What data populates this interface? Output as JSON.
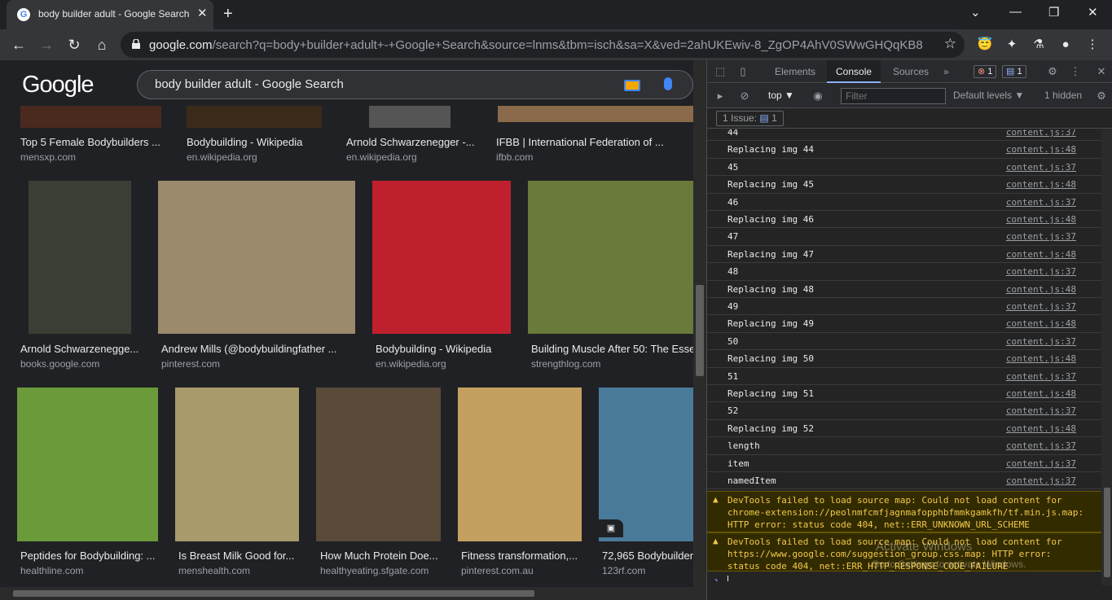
{
  "browser": {
    "tab_title": "body builder adult - Google Search",
    "url_host": "google.com",
    "url_rest": "/search?q=body+builder+adult+-+Google+Search&source=lnms&tbm=isch&sa=X&ved=2ahUKEwiv-8_ZgOP4AhV0SWwGHQqKB8cQ..."
  },
  "google": {
    "logo": "Google",
    "query": "body builder adult - Google Search"
  },
  "results": [
    {
      "caption": "Top 5 Female Bodybuilders ...",
      "source": "mensxp.com",
      "color": "#4a2a1e"
    },
    {
      "caption": "Bodybuilding - Wikipedia",
      "source": "en.wikipedia.org",
      "color": "#3b2a1a"
    },
    {
      "caption": "Arnold Schwarzenegger -...",
      "source": "en.wikipedia.org",
      "color": "#555555"
    },
    {
      "caption": "IFBB | International Federation of ...",
      "source": "ifbb.com",
      "color": "#8a6a4a"
    },
    {
      "caption": "Arnold Schwarzenegge...",
      "source": "books.google.com",
      "color": "#3a3f36"
    },
    {
      "caption": "Andrew Mills (@bodybuildingfather ...",
      "source": "pinterest.com",
      "color": "#9c8a6c"
    },
    {
      "caption": "Bodybuilding - Wikipedia",
      "source": "en.wikipedia.org",
      "color": "#c0202e"
    },
    {
      "caption": "Building Muscle After 50: The Esse",
      "source": "strengthlog.com",
      "color": "#6a7a3a"
    },
    {
      "caption": "Peptides for Bodybuilding: ...",
      "source": "healthline.com",
      "color": "#6a9a3a"
    },
    {
      "caption": "Is Breast Milk Good for...",
      "source": "menshealth.com",
      "color": "#a89a6a"
    },
    {
      "caption": "How Much Protein Doe...",
      "source": "healthyeating.sfgate.com",
      "color": "#5a4a3a"
    },
    {
      "caption": "Fitness transformation,...",
      "source": "pinterest.com.au",
      "color": "#c4a060"
    },
    {
      "caption": "72,965 Bodybuilder",
      "source": "123rf.com",
      "color": "#4a7a9a"
    }
  ],
  "devtools": {
    "tabs": [
      "Elements",
      "Console",
      "Sources"
    ],
    "active_tab": "Console",
    "more": "»",
    "errors_count": "1",
    "messages_count": "1",
    "context": "top ▼",
    "filter_placeholder": "Filter",
    "levels": "Default levels ▼",
    "hidden": "1 hidden",
    "issues_label": "1 Issue:",
    "issues_count": "1",
    "log": [
      {
        "msg": "44",
        "src": "content.js:37"
      },
      {
        "msg": "Replacing img 44",
        "src": "content.js:48"
      },
      {
        "msg": "45",
        "src": "content.js:37"
      },
      {
        "msg": "Replacing img 45",
        "src": "content.js:48"
      },
      {
        "msg": "46",
        "src": "content.js:37"
      },
      {
        "msg": "Replacing img 46",
        "src": "content.js:48"
      },
      {
        "msg": "47",
        "src": "content.js:37"
      },
      {
        "msg": "Replacing img 47",
        "src": "content.js:48"
      },
      {
        "msg": "48",
        "src": "content.js:37"
      },
      {
        "msg": "Replacing img 48",
        "src": "content.js:48"
      },
      {
        "msg": "49",
        "src": "content.js:37"
      },
      {
        "msg": "Replacing img 49",
        "src": "content.js:48"
      },
      {
        "msg": "50",
        "src": "content.js:37"
      },
      {
        "msg": "Replacing img 50",
        "src": "content.js:48"
      },
      {
        "msg": "51",
        "src": "content.js:37"
      },
      {
        "msg": "Replacing img 51",
        "src": "content.js:48"
      },
      {
        "msg": "52",
        "src": "content.js:37"
      },
      {
        "msg": "Replacing img 52",
        "src": "content.js:48"
      },
      {
        "msg": "length",
        "src": "content.js:37"
      },
      {
        "msg": "item",
        "src": "content.js:37"
      },
      {
        "msg": "namedItem",
        "src": "content.js:37"
      }
    ],
    "warnings": [
      "DevTools failed to load source map: Could not load content for chrome-extension://peolnmfcmfjagnmafopphbfmmkgamkfh/tf.min.js.map: HTTP error: status code 404, net::ERR_UNKNOWN_URL_SCHEME",
      "DevTools failed to load source map: Could not load content for https://www.google.com/suggestion_group.css.map: HTTP error: status code 404, net::ERR_HTTP_RESPONSE_CODE_FAILURE"
    ],
    "prompt": "›"
  },
  "watermark": {
    "line1": "Activate Windows",
    "line2": "Go to Settings to activate Windows."
  }
}
